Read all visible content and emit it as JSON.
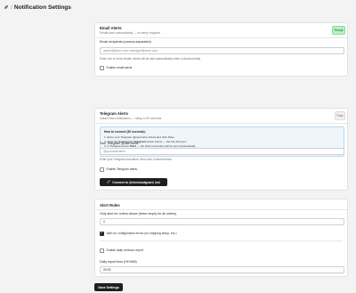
{
  "header": {
    "separator": "/",
    "title": "Notification Settings",
    "logo_icon": "leaf-icon"
  },
  "email_card": {
    "title": "Email Alerts",
    "subtitle": "Emails sent automatically — no setup required",
    "badge": "Ready",
    "recipients_label": "Email recipients (comma-separated)",
    "recipients_placeholder": "owner@store.com, manager@store.com",
    "recipients_hint": "Enter one or more emails. Alerts will be sent automatically when a checkout fails.",
    "enable_label": "Enable email alerts",
    "enable_checked": false
  },
  "telegram_card": {
    "title": "Telegram Alerts",
    "subtitle": "Instant free notifications — setup in 30 seconds",
    "badge": "Free",
    "info": {
      "title": "How to connect (30 seconds):",
      "step1": "1. Enter your Telegram @username below and click Save",
      "step2_prefix": "2. Click the ",
      "step2_bold": "Connect to Telegram",
      "step2_suffix": " button below — the bot will open",
      "step3_prefix": "3. In Telegram press ",
      "step3_bold": "Start",
      "step3_suffix": " — the chat connection will be sent automatically",
      "step4": "4. The bot will send a confirmation — notifications are now active"
    },
    "username_label": "Your Telegram @username",
    "username_placeholder": "@yourusername",
    "username_hint": "Enter your Telegram username, then click Connect below",
    "enable_label": "Enable Telegram alerts",
    "enable_checked": false,
    "connect_button": "Connect to @checkoutguard_bot",
    "connect_icon": "link-icon"
  },
  "rules_card": {
    "title": "Alert Rules",
    "min_order_label": "Only alert for orders above (leave empty for all orders)",
    "min_order_value": "0",
    "config_errors_label": "Alert on configuration errors (no shipping setup, etc.)",
    "config_errors_checked": true,
    "daily_report_label": "Enable daily revenue report",
    "daily_report_checked": false,
    "report_time_label": "Daily report time (HH:MM)",
    "report_time_value": "09:00"
  },
  "save_button": "Save Settings",
  "colors": {
    "background": "#f3f3f4",
    "ready_badge": "#b8f0c0",
    "info_box": "#eef6fc",
    "primary_button": "#1f1f1f"
  }
}
